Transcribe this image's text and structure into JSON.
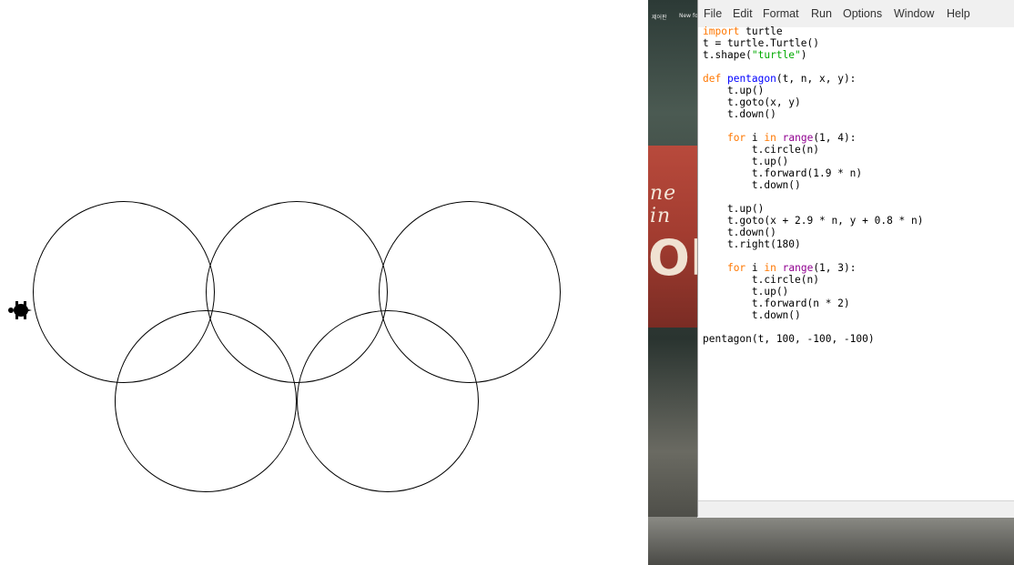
{
  "turtle_window": {
    "colors": {
      "background": "#ffffff",
      "stroke": "#000000"
    },
    "turtle_icon": "turtle-shape"
  },
  "editor": {
    "menu": [
      "File",
      "Edit",
      "Format",
      "Run",
      "Options",
      "Window",
      "Help"
    ],
    "code_lines": [
      [
        [
          "kw",
          "import"
        ],
        [
          "",
          " turtle"
        ]
      ],
      [
        [
          "",
          "t = turtle.Turtle()"
        ]
      ],
      [
        [
          "",
          "t.shape("
        ],
        [
          "str",
          "\"turtle\""
        ],
        [
          "",
          ")"
        ]
      ],
      [],
      [
        [
          "kw",
          "def"
        ],
        [
          "",
          " "
        ],
        [
          "fn",
          "pentagon"
        ],
        [
          "",
          "(t, n, x, y):"
        ]
      ],
      [
        [
          "",
          "    t.up()"
        ]
      ],
      [
        [
          "",
          "    t.goto(x, y)"
        ]
      ],
      [
        [
          "",
          "    t.down()"
        ]
      ],
      [],
      [
        [
          "",
          "    "
        ],
        [
          "kw",
          "for"
        ],
        [
          "",
          " i "
        ],
        [
          "kw",
          "in"
        ],
        [
          "",
          " "
        ],
        [
          "bi",
          "range"
        ],
        [
          "",
          "(1, 4):"
        ]
      ],
      [
        [
          "",
          "        t.circle(n)"
        ]
      ],
      [
        [
          "",
          "        t.up()"
        ]
      ],
      [
        [
          "",
          "        t.forward(1.9 * n)"
        ]
      ],
      [
        [
          "",
          "        t.down()"
        ]
      ],
      [],
      [
        [
          "",
          "    t.up()"
        ]
      ],
      [
        [
          "",
          "    t.goto(x + 2.9 * n, y + 0.8 * n)"
        ]
      ],
      [
        [
          "",
          "    t.down()"
        ]
      ],
      [
        [
          "",
          "    t.right(180)"
        ]
      ],
      [],
      [
        [
          "",
          "    "
        ],
        [
          "kw",
          "for"
        ],
        [
          "",
          " i "
        ],
        [
          "kw",
          "in"
        ],
        [
          "",
          " "
        ],
        [
          "bi",
          "range"
        ],
        [
          "",
          "(1, 3):"
        ]
      ],
      [
        [
          "",
          "        t.circle(n)"
        ]
      ],
      [
        [
          "",
          "        t.up()"
        ]
      ],
      [
        [
          "",
          "        t.forward(n * 2)"
        ]
      ],
      [
        [
          "",
          "        t.down()"
        ]
      ],
      [],
      [
        [
          "",
          "pentagon(t, 100, -100, -100)"
        ]
      ]
    ],
    "syntax_colors": {
      "keyword": "#ff7700",
      "string": "#00aa00",
      "definition": "#0000ff",
      "builtin": "#900090"
    }
  },
  "wallpaper": {
    "sign_text": "ne in",
    "sign_big": "OP",
    "icon_labels": [
      "제어판",
      "New fo"
    ]
  }
}
